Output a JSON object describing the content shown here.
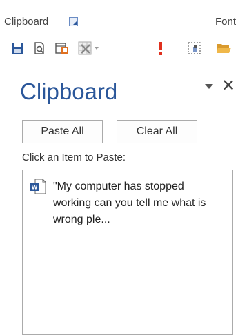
{
  "ribbon": {
    "groups": {
      "clipboard_label": "Clipboard",
      "font_label": "Font"
    }
  },
  "qat": {
    "icons": [
      "save-icon",
      "print-preview-icon",
      "table-icon",
      "delete-icon",
      "exclamation-icon",
      "select-icon",
      "open-folder-icon"
    ],
    "colors": {
      "save": "#2b579a",
      "exclamation": "#e0301e",
      "folder": "#e8a33a",
      "table_accent": "#e07020"
    }
  },
  "pane": {
    "title": "Clipboard",
    "paste_all_label": "Paste All",
    "clear_all_label": "Clear All",
    "hint": "Click an Item to Paste:",
    "items": [
      {
        "icon": "word-document-icon",
        "text": "\"My computer has stopped working can you tell me what is wrong ple..."
      }
    ],
    "title_color": "#2b579a"
  }
}
